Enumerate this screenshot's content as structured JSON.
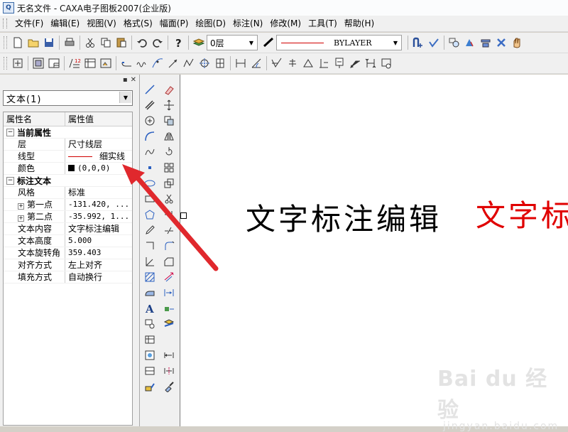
{
  "window": {
    "title": "无名文件 - CAXA电子图板2007(企业版)"
  },
  "menu": [
    "文件(F)",
    "编辑(E)",
    "视图(V)",
    "格式(S)",
    "幅面(P)",
    "绘图(D)",
    "标注(N)",
    "修改(M)",
    "工具(T)",
    "帮助(H)"
  ],
  "toolbar": {
    "layer_value": "0层",
    "color_value": "BYLAYER"
  },
  "panel": {
    "object_select": "文本(1)",
    "header_name": "属性名",
    "header_value": "属性值",
    "groups": {
      "current": "当前属性",
      "annotation": "标注文本"
    },
    "current": {
      "layer_name": "层",
      "layer_value": "尺寸线层",
      "linetype_name": "线型",
      "linetype_value": "细实线",
      "color_name": "颜色",
      "color_value": "(0,0,0)"
    },
    "annotation": {
      "style_name": "风格",
      "style_value": "标准",
      "p1_name": "第一点",
      "p1_value": "-131.420, ...",
      "p2_name": "第二点",
      "p2_value": "-35.992, 1...",
      "content_name": "文本内容",
      "content_value": "文字标注编辑",
      "height_name": "文本高度",
      "height_value": "5.000",
      "angle_name": "文本旋转角",
      "angle_value": "359.403",
      "align_name": "对齐方式",
      "align_value": "左上对齐",
      "fill_name": "填充方式",
      "fill_value": "自动换行"
    }
  },
  "canvas": {
    "text_black": "文字标注编辑",
    "text_red": "文字标注",
    "red_color": "#e00000",
    "arrow_color": "#e0282d"
  },
  "watermark": {
    "brand": "Bai du 经验",
    "url": "jingyan.baidu.com"
  }
}
